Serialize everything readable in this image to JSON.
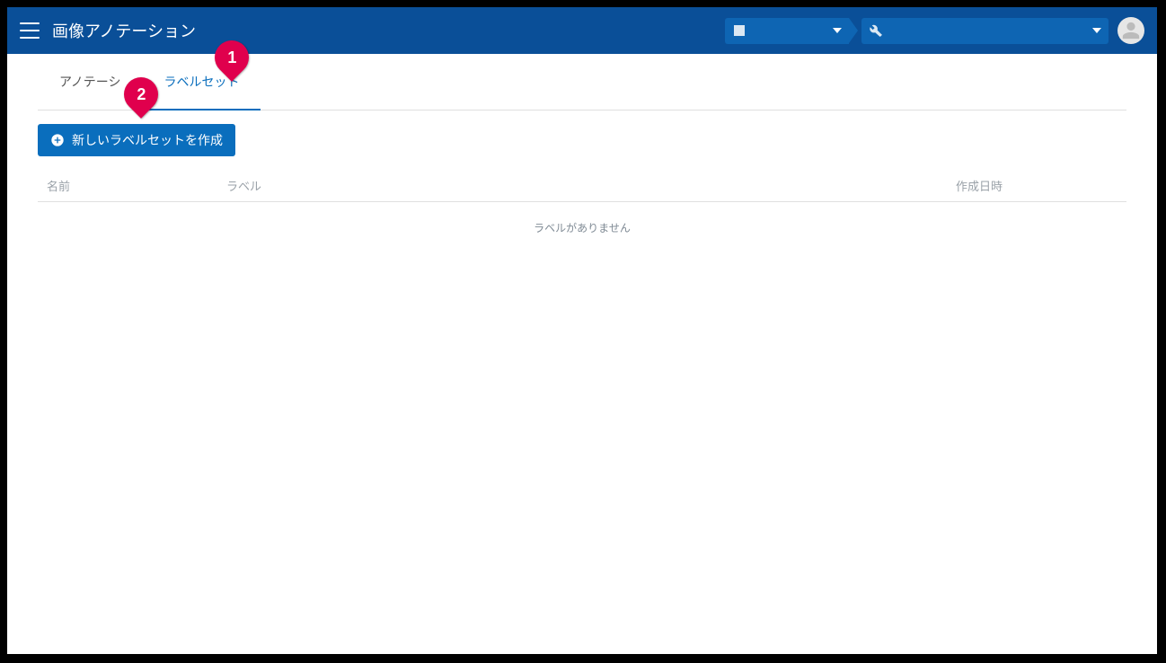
{
  "header": {
    "title": "画像アノテーション"
  },
  "tabs": {
    "annotation": "アノテーシ",
    "labelset": "ラベルセット"
  },
  "toolbar": {
    "create_labelset": "新しいラベルセットを作成"
  },
  "table": {
    "headers": {
      "name": "名前",
      "label": "ラベル",
      "created": "作成日時"
    },
    "empty": "ラベルがありません"
  },
  "callouts": {
    "c1": "1",
    "c2": "2"
  }
}
